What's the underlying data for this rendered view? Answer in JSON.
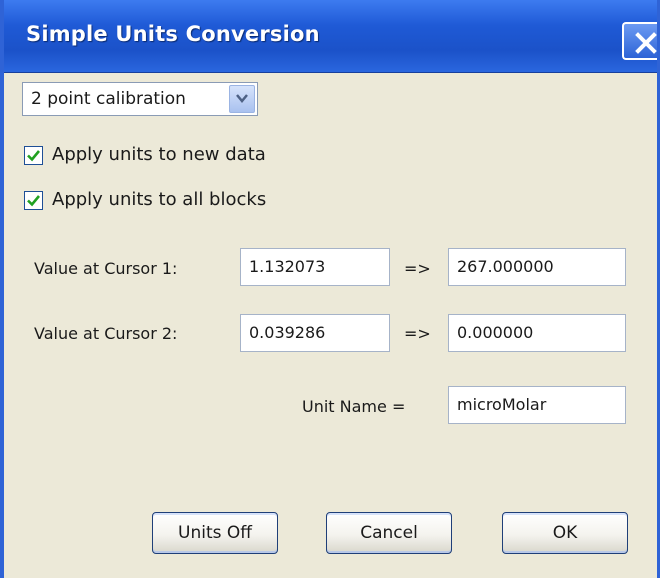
{
  "window": {
    "title": "Simple Units Conversion"
  },
  "calibration": {
    "selected": "2 point calibration"
  },
  "options": {
    "apply_new_data": {
      "label": "Apply units to new data",
      "checked": true
    },
    "apply_all_blocks": {
      "label": "Apply units to all blocks",
      "checked": true
    }
  },
  "cursor1": {
    "label": "Value at Cursor 1:",
    "value": "1.132073",
    "arrow": "=>",
    "converted": "267.000000"
  },
  "cursor2": {
    "label": "Value at Cursor 2:",
    "value": "0.039286",
    "arrow": "=>",
    "converted": "0.000000"
  },
  "unit": {
    "label": "Unit Name =",
    "value": "microMolar"
  },
  "buttons": {
    "units_off": "Units Off",
    "cancel": "Cancel",
    "ok": "OK"
  },
  "colors": {
    "titlebar": "#1f5ad6",
    "dialog_bg": "#ece9d8",
    "check_mark": "#21a121"
  }
}
